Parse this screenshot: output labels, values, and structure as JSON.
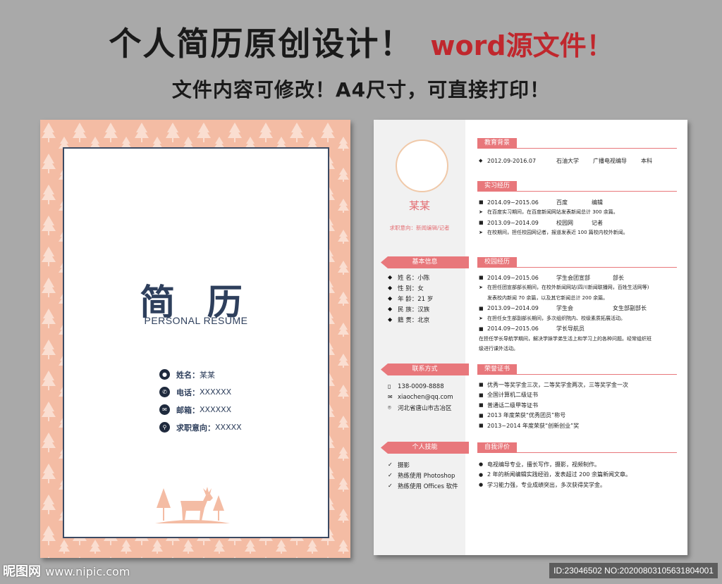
{
  "headline": {
    "main": "个人简历原创设计！",
    "accent": "word源文件！",
    "sub": "文件内容可修改！A4尺寸，可直接打印！"
  },
  "cover": {
    "title": "简 历",
    "subtitle": "PERSONAL RESUME",
    "info": [
      {
        "icon": "person-icon",
        "label": "姓名：",
        "value": "某某"
      },
      {
        "icon": "phone-icon",
        "label": "电话：",
        "value": "XXXXXX"
      },
      {
        "icon": "mail-icon",
        "label": "邮箱：",
        "value": "XXXXXX"
      },
      {
        "icon": "search-icon",
        "label": "求职意向：",
        "value": "XXXXX"
      }
    ],
    "colors": {
      "pattern": "#f4bca4",
      "frame": "#3b4a63",
      "text": "#2e3f5c"
    }
  },
  "resume": {
    "name": "某某",
    "intent": "求职意向：新闻编辑/记者",
    "sidebar": {
      "basic_label": "基本信息",
      "basic": [
        {
          "label": "姓 名：",
          "value": "小陈"
        },
        {
          "label": "性 别：",
          "value": "女"
        },
        {
          "label": "年 龄：",
          "value": "21 岁"
        },
        {
          "label": "民 族：",
          "value": "汉族"
        },
        {
          "label": "籍 贯：",
          "value": "北京"
        }
      ],
      "contact_label": "联系方式",
      "contact": [
        {
          "icon": "phone-icon",
          "value": "138-0009-8888"
        },
        {
          "icon": "mail-icon",
          "value": "xiaochen@qq.com"
        },
        {
          "icon": "location-icon",
          "value": "河北省唐山市古冶区"
        }
      ],
      "skills_label": "个人技能",
      "skills": [
        "摄影",
        "熟练使用 Photoshop",
        "熟练使用 Offices 软件"
      ]
    },
    "education": {
      "title": "教育背景",
      "rows": [
        {
          "date": "2012.09-2016.07",
          "org": "石油大学",
          "role": "广播电视编导",
          "extra": "本科"
        }
      ]
    },
    "internship": {
      "title": "实习经历",
      "items": [
        {
          "date": "2014.09~2015.06",
          "org": "百度",
          "role": "编辑",
          "desc": "在百度实习期间，在百度新闻网站发表新闻总计 300 余篇。"
        },
        {
          "date": "2013.09~2014.09",
          "org": "校园网",
          "role": "记者",
          "desc": "在校期间，担任校园网记者，报道发表近 100 篇校内校外新闻。"
        }
      ]
    },
    "campus": {
      "title": "校园经历",
      "items": [
        {
          "date": "2014.09~2015.06",
          "org": "学生会团宣部",
          "role": "部长",
          "desc": [
            "在担任团宣部部长期间，在校外新闻网站(四川新闻联播网，百姓生活网等)",
            "发表校内新闻 70 余篇，以及其它新闻总计 200 余篇。"
          ]
        },
        {
          "date": "2013.09~2014.09",
          "org": "学生会",
          "role": "女生部副部长",
          "desc": [
            "在担任女生部副部长期间，多次组织院内、校级素质拓展活动。"
          ]
        },
        {
          "date": "2014.09~2015.06",
          "org": "学长导航员",
          "role": "",
          "desc": [
            "在担任学长导航学期间，解决学妹学弟生活上和学习上的各种问题。经常组织班",
            "级进行课外活动。"
          ]
        }
      ]
    },
    "honors": {
      "title": "荣誉证书",
      "items": [
        "优秀一等奖学金三次，二等奖学金两次，三等奖学金一次",
        "全国计算机二级证书",
        "普通话二级甲等证书",
        "2013 年度荣获“优秀团员”称号",
        "2013~2014 年度荣获“创新创业”奖"
      ]
    },
    "self": {
      "title": "自我评价",
      "items": [
        "电视编导专业，擅长写作，摄影，视频制作。",
        "2 年的新闻编辑实践经验，发表超过 200 余篇新闻文章。",
        "学习能力强，专业成绩突出，多次获得奖学金。"
      ]
    },
    "colors": {
      "accent": "#e8777b",
      "sidebar": "#f1f1f1"
    }
  },
  "footer": {
    "logo": "昵图网",
    "url": "www.nipic.com",
    "id": "ID:23046502 NO:20200803105631804001"
  }
}
